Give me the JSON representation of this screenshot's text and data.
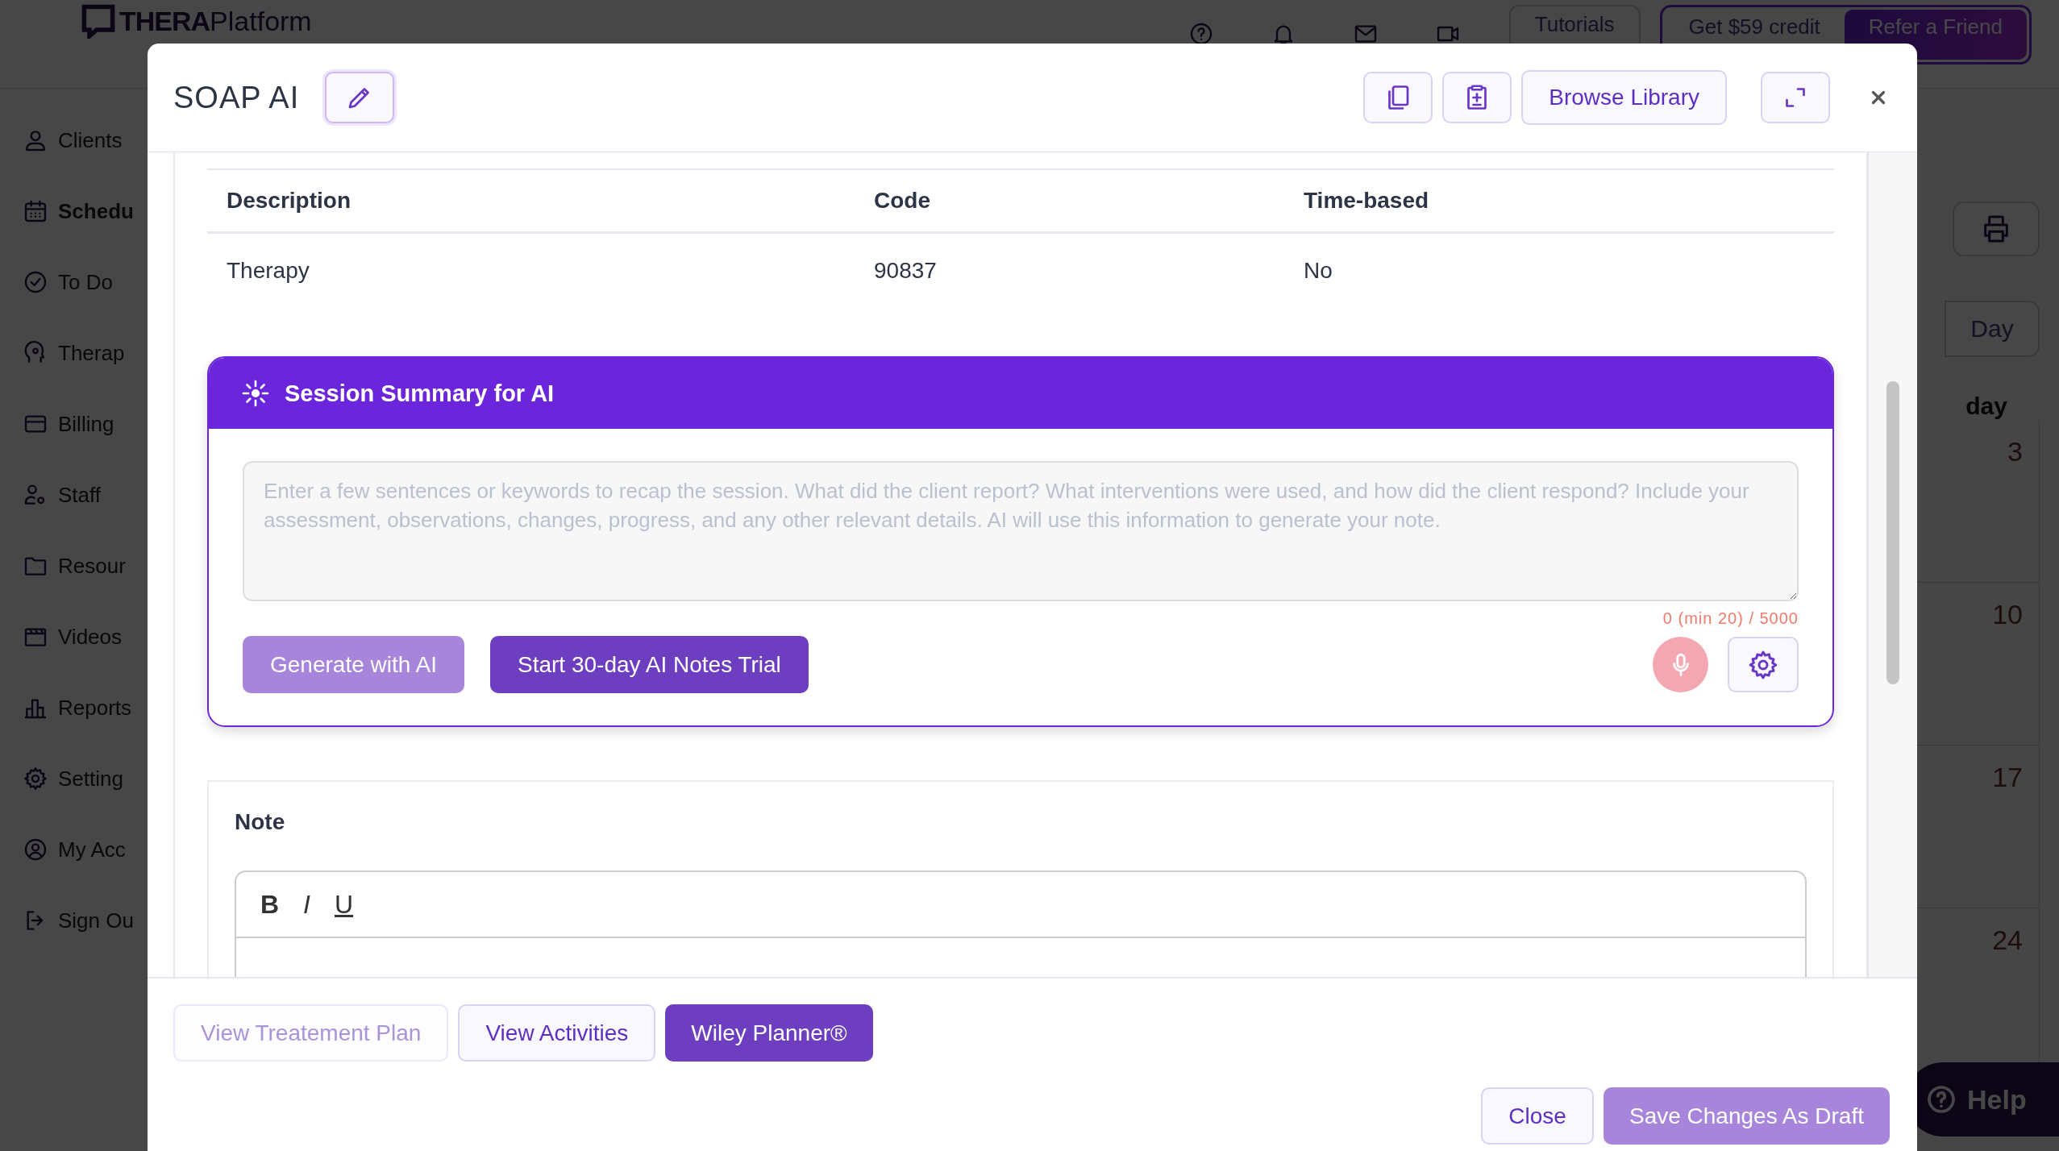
{
  "app": {
    "logo": {
      "strong": "THERA",
      "light": "Platform"
    },
    "header": {
      "tutorials": "Tutorials",
      "credit": "Get $59 credit",
      "refer": "Refer a Friend"
    },
    "sidebar": {
      "items": [
        {
          "label": "Clients",
          "selected": false
        },
        {
          "label": "Schedu",
          "selected": true
        },
        {
          "label": "To Do",
          "selected": false
        },
        {
          "label": "Therap",
          "selected": false
        },
        {
          "label": "Billing",
          "selected": false
        },
        {
          "label": "Staff",
          "selected": false
        },
        {
          "label": "Resour",
          "selected": false
        },
        {
          "label": "Videos",
          "selected": false
        },
        {
          "label": "Reports",
          "selected": false
        },
        {
          "label": "Setting",
          "selected": false
        },
        {
          "label": "My Acc",
          "selected": false
        },
        {
          "label": "Sign Ou",
          "selected": false
        }
      ]
    },
    "calendar": {
      "view_tab": "Day",
      "weekday": "day",
      "dates": [
        "3",
        "10",
        "17",
        "24"
      ]
    },
    "help": "Help"
  },
  "modal": {
    "title": "SOAP AI",
    "toolbar": [
      {
        "kind": "copy"
      },
      {
        "kind": "document"
      },
      {
        "kind": "text",
        "label": "Browse Library"
      },
      {
        "kind": "expand"
      }
    ],
    "table": {
      "columns": [
        "Description",
        "Code",
        "Time-based"
      ],
      "rows": [
        [
          "Therapy",
          "90837",
          "No"
        ]
      ]
    },
    "ai_summary": {
      "title": "Session Summary for AI",
      "placeholder": "Enter a few sentences or keywords to recap the session. What did the client report? What interventions were used, and how did the client respond? Include your assessment, observations, changes, progress, and any other relevant details. AI will use this information to generate your note.",
      "counter": "0 (min 20) / 5000",
      "buttons": [
        {
          "label": "Generate with AI",
          "disabled": true
        },
        {
          "label": "Start 30-day AI Notes Trial",
          "disabled": false
        }
      ],
      "mic": {
        "disabled": true
      }
    },
    "note": {
      "title": "Note",
      "format_buttons": [
        {
          "kind": "bold",
          "label": "B"
        },
        {
          "kind": "italic",
          "label": "I"
        },
        {
          "kind": "underline",
          "label": "U"
        }
      ]
    },
    "footer_left": [
      {
        "label": "View Treatement Plan",
        "kind": "outline",
        "disabled": true
      },
      {
        "label": "View Activities",
        "kind": "outline",
        "disabled": false
      },
      {
        "label": "Wiley Planner®",
        "kind": "solid",
        "disabled": false
      }
    ],
    "footer_right": [
      {
        "label": "Close",
        "kind": "outline",
        "disabled": false
      },
      {
        "label": "Save Changes As Draft",
        "kind": "solid",
        "disabled": true
      }
    ]
  }
}
